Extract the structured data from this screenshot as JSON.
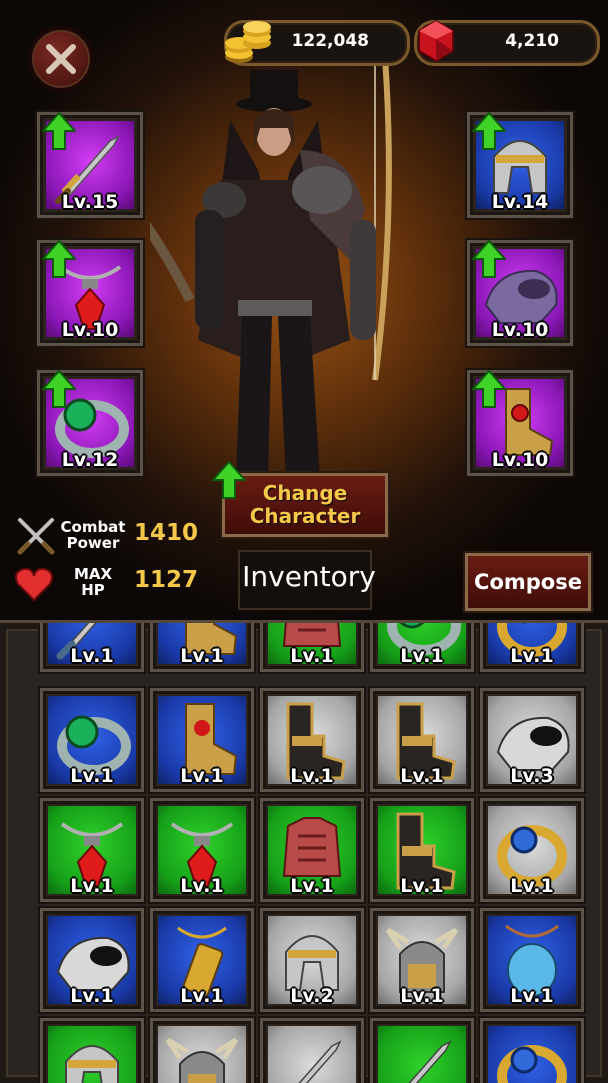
{
  "currency": {
    "gold": "122,048",
    "gems": "4,210"
  },
  "equipment": {
    "left": [
      {
        "name": "sword",
        "level": "Lv.15",
        "bg": "purple",
        "upgrade": true
      },
      {
        "name": "necklace",
        "level": "Lv.10",
        "bg": "purple",
        "upgrade": true
      },
      {
        "name": "ring",
        "level": "Lv.12",
        "bg": "purple",
        "upgrade": true
      }
    ],
    "right": [
      {
        "name": "helmet",
        "level": "Lv.14",
        "bg": "blue",
        "upgrade": true
      },
      {
        "name": "shoulder",
        "level": "Lv.10",
        "bg": "purple",
        "upgrade": true
      },
      {
        "name": "boots",
        "level": "Lv.10",
        "bg": "purple",
        "upgrade": true
      }
    ]
  },
  "stats": {
    "combat_label_1": "Combat",
    "combat_label_2": "Power",
    "combat_value": "1410",
    "hp_label_1": "MAX",
    "hp_label_2": "HP",
    "hp_value": "1127"
  },
  "buttons": {
    "change_1": "Change",
    "change_2": "Character",
    "inventory": "Inventory",
    "compose": "Compose"
  },
  "inventory": [
    [
      {
        "item": "sword",
        "level": "Lv.1",
        "bg": "blue"
      },
      {
        "item": "boots",
        "level": "Lv.1",
        "bg": "blue"
      },
      {
        "item": "armor",
        "level": "Lv.1",
        "bg": "green"
      },
      {
        "item": "ring",
        "level": "Lv.1",
        "bg": "green"
      },
      {
        "item": "ring-gold",
        "level": "Lv.1",
        "bg": "blue"
      }
    ],
    [
      {
        "item": "ring",
        "level": "Lv.1",
        "bg": "blue"
      },
      {
        "item": "boots",
        "level": "Lv.1",
        "bg": "blue"
      },
      {
        "item": "greaves",
        "level": "Lv.1",
        "bg": "grey"
      },
      {
        "item": "greaves",
        "level": "Lv.1",
        "bg": "grey"
      },
      {
        "item": "shoulder",
        "level": "Lv.3",
        "bg": "grey"
      }
    ],
    [
      {
        "item": "necklace",
        "level": "Lv.1",
        "bg": "green"
      },
      {
        "item": "necklace",
        "level": "Lv.1",
        "bg": "green"
      },
      {
        "item": "armor",
        "level": "Lv.1",
        "bg": "green"
      },
      {
        "item": "greaves",
        "level": "Lv.1",
        "bg": "green"
      },
      {
        "item": "ring-gold",
        "level": "Lv.1",
        "bg": "grey"
      }
    ],
    [
      {
        "item": "shoulder",
        "level": "Lv.1",
        "bg": "blue"
      },
      {
        "item": "amulet",
        "level": "Lv.1",
        "bg": "blue"
      },
      {
        "item": "helmet",
        "level": "Lv.2",
        "bg": "grey"
      },
      {
        "item": "horned-helmet",
        "level": "Lv.1",
        "bg": "grey"
      },
      {
        "item": "gem-pendant",
        "level": "Lv.1",
        "bg": "blue"
      }
    ],
    [
      {
        "item": "helmet",
        "level": "",
        "bg": "green"
      },
      {
        "item": "horned-helmet",
        "level": "",
        "bg": "grey"
      },
      {
        "item": "sword",
        "level": "",
        "bg": "grey"
      },
      {
        "item": "sword",
        "level": "",
        "bg": "green"
      },
      {
        "item": "ring-gold",
        "level": "",
        "bg": "blue"
      }
    ]
  ]
}
